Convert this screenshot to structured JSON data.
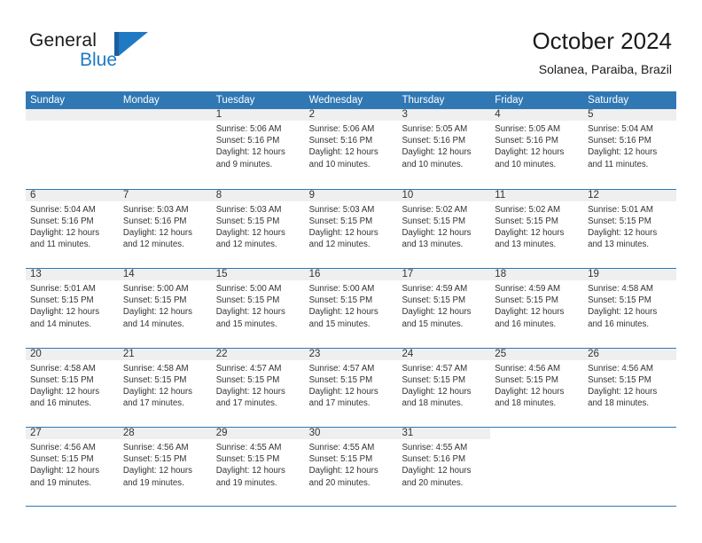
{
  "brand": {
    "word_one": "General",
    "word_two": "Blue",
    "mark": "triangle-logo"
  },
  "header": {
    "title": "October 2024",
    "subtitle": "Solanea, Paraiba, Brazil"
  },
  "colors": {
    "header_blue": "#3078b4",
    "brand_blue": "#1f7ac4",
    "brand_dark_blue": "#1d5f9e",
    "day_band_gray": "#efefef",
    "text": "#333333"
  },
  "weekdays": [
    "Sunday",
    "Monday",
    "Tuesday",
    "Wednesday",
    "Thursday",
    "Friday",
    "Saturday"
  ],
  "labels": {
    "sunrise_prefix": "Sunrise:",
    "sunset_prefix": "Sunset:",
    "daylight_prefix": "Daylight:"
  },
  "weeks": [
    [
      {
        "day": "",
        "empty": true
      },
      {
        "day": "",
        "empty": true
      },
      {
        "day": "1",
        "sunrise": "Sunrise: 5:06 AM",
        "sunset": "Sunset: 5:16 PM",
        "daylight_1": "Daylight: 12 hours",
        "daylight_2": "and 9 minutes."
      },
      {
        "day": "2",
        "sunrise": "Sunrise: 5:06 AM",
        "sunset": "Sunset: 5:16 PM",
        "daylight_1": "Daylight: 12 hours",
        "daylight_2": "and 10 minutes."
      },
      {
        "day": "3",
        "sunrise": "Sunrise: 5:05 AM",
        "sunset": "Sunset: 5:16 PM",
        "daylight_1": "Daylight: 12 hours",
        "daylight_2": "and 10 minutes."
      },
      {
        "day": "4",
        "sunrise": "Sunrise: 5:05 AM",
        "sunset": "Sunset: 5:16 PM",
        "daylight_1": "Daylight: 12 hours",
        "daylight_2": "and 10 minutes."
      },
      {
        "day": "5",
        "sunrise": "Sunrise: 5:04 AM",
        "sunset": "Sunset: 5:16 PM",
        "daylight_1": "Daylight: 12 hours",
        "daylight_2": "and 11 minutes."
      }
    ],
    [
      {
        "day": "6",
        "sunrise": "Sunrise: 5:04 AM",
        "sunset": "Sunset: 5:16 PM",
        "daylight_1": "Daylight: 12 hours",
        "daylight_2": "and 11 minutes."
      },
      {
        "day": "7",
        "sunrise": "Sunrise: 5:03 AM",
        "sunset": "Sunset: 5:16 PM",
        "daylight_1": "Daylight: 12 hours",
        "daylight_2": "and 12 minutes."
      },
      {
        "day": "8",
        "sunrise": "Sunrise: 5:03 AM",
        "sunset": "Sunset: 5:15 PM",
        "daylight_1": "Daylight: 12 hours",
        "daylight_2": "and 12 minutes."
      },
      {
        "day": "9",
        "sunrise": "Sunrise: 5:03 AM",
        "sunset": "Sunset: 5:15 PM",
        "daylight_1": "Daylight: 12 hours",
        "daylight_2": "and 12 minutes."
      },
      {
        "day": "10",
        "sunrise": "Sunrise: 5:02 AM",
        "sunset": "Sunset: 5:15 PM",
        "daylight_1": "Daylight: 12 hours",
        "daylight_2": "and 13 minutes."
      },
      {
        "day": "11",
        "sunrise": "Sunrise: 5:02 AM",
        "sunset": "Sunset: 5:15 PM",
        "daylight_1": "Daylight: 12 hours",
        "daylight_2": "and 13 minutes."
      },
      {
        "day": "12",
        "sunrise": "Sunrise: 5:01 AM",
        "sunset": "Sunset: 5:15 PM",
        "daylight_1": "Daylight: 12 hours",
        "daylight_2": "and 13 minutes."
      }
    ],
    [
      {
        "day": "13",
        "sunrise": "Sunrise: 5:01 AM",
        "sunset": "Sunset: 5:15 PM",
        "daylight_1": "Daylight: 12 hours",
        "daylight_2": "and 14 minutes."
      },
      {
        "day": "14",
        "sunrise": "Sunrise: 5:00 AM",
        "sunset": "Sunset: 5:15 PM",
        "daylight_1": "Daylight: 12 hours",
        "daylight_2": "and 14 minutes."
      },
      {
        "day": "15",
        "sunrise": "Sunrise: 5:00 AM",
        "sunset": "Sunset: 5:15 PM",
        "daylight_1": "Daylight: 12 hours",
        "daylight_2": "and 15 minutes."
      },
      {
        "day": "16",
        "sunrise": "Sunrise: 5:00 AM",
        "sunset": "Sunset: 5:15 PM",
        "daylight_1": "Daylight: 12 hours",
        "daylight_2": "and 15 minutes."
      },
      {
        "day": "17",
        "sunrise": "Sunrise: 4:59 AM",
        "sunset": "Sunset: 5:15 PM",
        "daylight_1": "Daylight: 12 hours",
        "daylight_2": "and 15 minutes."
      },
      {
        "day": "18",
        "sunrise": "Sunrise: 4:59 AM",
        "sunset": "Sunset: 5:15 PM",
        "daylight_1": "Daylight: 12 hours",
        "daylight_2": "and 16 minutes."
      },
      {
        "day": "19",
        "sunrise": "Sunrise: 4:58 AM",
        "sunset": "Sunset: 5:15 PM",
        "daylight_1": "Daylight: 12 hours",
        "daylight_2": "and 16 minutes."
      }
    ],
    [
      {
        "day": "20",
        "sunrise": "Sunrise: 4:58 AM",
        "sunset": "Sunset: 5:15 PM",
        "daylight_1": "Daylight: 12 hours",
        "daylight_2": "and 16 minutes."
      },
      {
        "day": "21",
        "sunrise": "Sunrise: 4:58 AM",
        "sunset": "Sunset: 5:15 PM",
        "daylight_1": "Daylight: 12 hours",
        "daylight_2": "and 17 minutes."
      },
      {
        "day": "22",
        "sunrise": "Sunrise: 4:57 AM",
        "sunset": "Sunset: 5:15 PM",
        "daylight_1": "Daylight: 12 hours",
        "daylight_2": "and 17 minutes."
      },
      {
        "day": "23",
        "sunrise": "Sunrise: 4:57 AM",
        "sunset": "Sunset: 5:15 PM",
        "daylight_1": "Daylight: 12 hours",
        "daylight_2": "and 17 minutes."
      },
      {
        "day": "24",
        "sunrise": "Sunrise: 4:57 AM",
        "sunset": "Sunset: 5:15 PM",
        "daylight_1": "Daylight: 12 hours",
        "daylight_2": "and 18 minutes."
      },
      {
        "day": "25",
        "sunrise": "Sunrise: 4:56 AM",
        "sunset": "Sunset: 5:15 PM",
        "daylight_1": "Daylight: 12 hours",
        "daylight_2": "and 18 minutes."
      },
      {
        "day": "26",
        "sunrise": "Sunrise: 4:56 AM",
        "sunset": "Sunset: 5:15 PM",
        "daylight_1": "Daylight: 12 hours",
        "daylight_2": "and 18 minutes."
      }
    ],
    [
      {
        "day": "27",
        "sunrise": "Sunrise: 4:56 AM",
        "sunset": "Sunset: 5:15 PM",
        "daylight_1": "Daylight: 12 hours",
        "daylight_2": "and 19 minutes."
      },
      {
        "day": "28",
        "sunrise": "Sunrise: 4:56 AM",
        "sunset": "Sunset: 5:15 PM",
        "daylight_1": "Daylight: 12 hours",
        "daylight_2": "and 19 minutes."
      },
      {
        "day": "29",
        "sunrise": "Sunrise: 4:55 AM",
        "sunset": "Sunset: 5:15 PM",
        "daylight_1": "Daylight: 12 hours",
        "daylight_2": "and 19 minutes."
      },
      {
        "day": "30",
        "sunrise": "Sunrise: 4:55 AM",
        "sunset": "Sunset: 5:15 PM",
        "daylight_1": "Daylight: 12 hours",
        "daylight_2": "and 20 minutes."
      },
      {
        "day": "31",
        "sunrise": "Sunrise: 4:55 AM",
        "sunset": "Sunset: 5:16 PM",
        "daylight_1": "Daylight: 12 hours",
        "daylight_2": "and 20 minutes."
      },
      {
        "day": "",
        "empty": true,
        "blank": true
      },
      {
        "day": "",
        "empty": true,
        "blank": true
      }
    ]
  ]
}
